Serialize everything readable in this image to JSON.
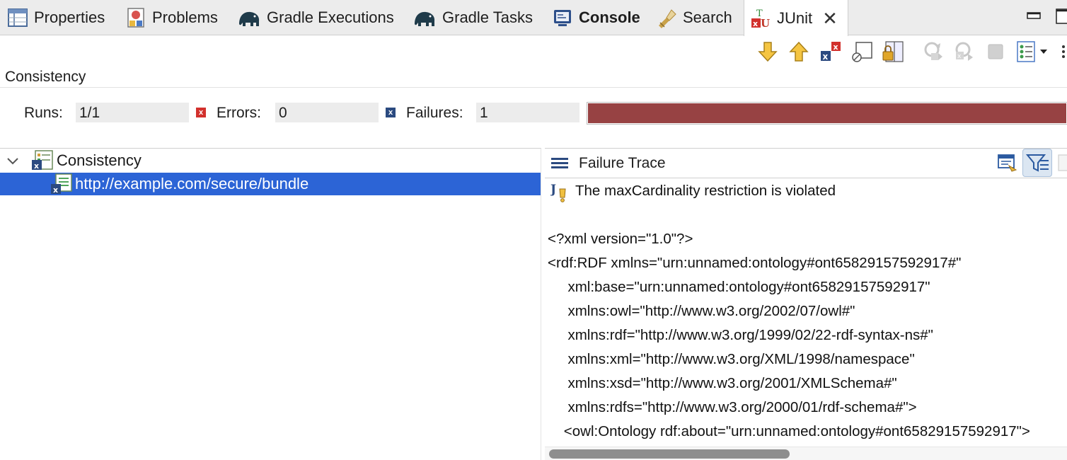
{
  "tabs": [
    {
      "label": "Properties",
      "icon": "properties-icon"
    },
    {
      "label": "Problems",
      "icon": "problems-icon"
    },
    {
      "label": "Gradle Executions",
      "icon": "gradle-elephant-icon"
    },
    {
      "label": "Gradle Tasks",
      "icon": "gradle-elephant-icon"
    },
    {
      "label": "Console",
      "icon": "console-icon"
    },
    {
      "label": "Search",
      "icon": "search-flashlight-icon"
    },
    {
      "label": "JUnit",
      "icon": "junit-icon"
    }
  ],
  "junit": {
    "suite_title": "Consistency",
    "runs_label": "Runs:",
    "runs_value": "1/1",
    "errors_label": "Errors:",
    "errors_value": "0",
    "failures_label": "Failures:",
    "failures_value": "1",
    "progress_fraction": 1.0,
    "progress_color": "#974243"
  },
  "tree": {
    "root_label": "Consistency",
    "child_label": "http://example.com/secure/bundle"
  },
  "trace": {
    "title": "Failure Trace",
    "lines": [
      "The maxCardinality restriction is violated",
      "",
      "<?xml version=\"1.0\"?>",
      "<rdf:RDF xmlns=\"urn:unnamed:ontology#ont65829157592917#\"",
      "     xml:base=\"urn:unnamed:ontology#ont65829157592917\"",
      "     xmlns:owl=\"http://www.w3.org/2002/07/owl#\"",
      "     xmlns:rdf=\"http://www.w3.org/1999/02/22-rdf-syntax-ns#\"",
      "     xmlns:xml=\"http://www.w3.org/XML/1998/namespace\"",
      "     xmlns:xsd=\"http://www.w3.org/2001/XMLSchema#\"",
      "     xmlns:rdfs=\"http://www.w3.org/2000/01/rdf-schema#\">",
      "    <owl:Ontology rdf:about=\"urn:unnamed:ontology#ont65829157592917\">"
    ]
  },
  "colors": {
    "selection": "#2c64d6",
    "failure_bar": "#974243",
    "tab_bar": "#ececec"
  }
}
